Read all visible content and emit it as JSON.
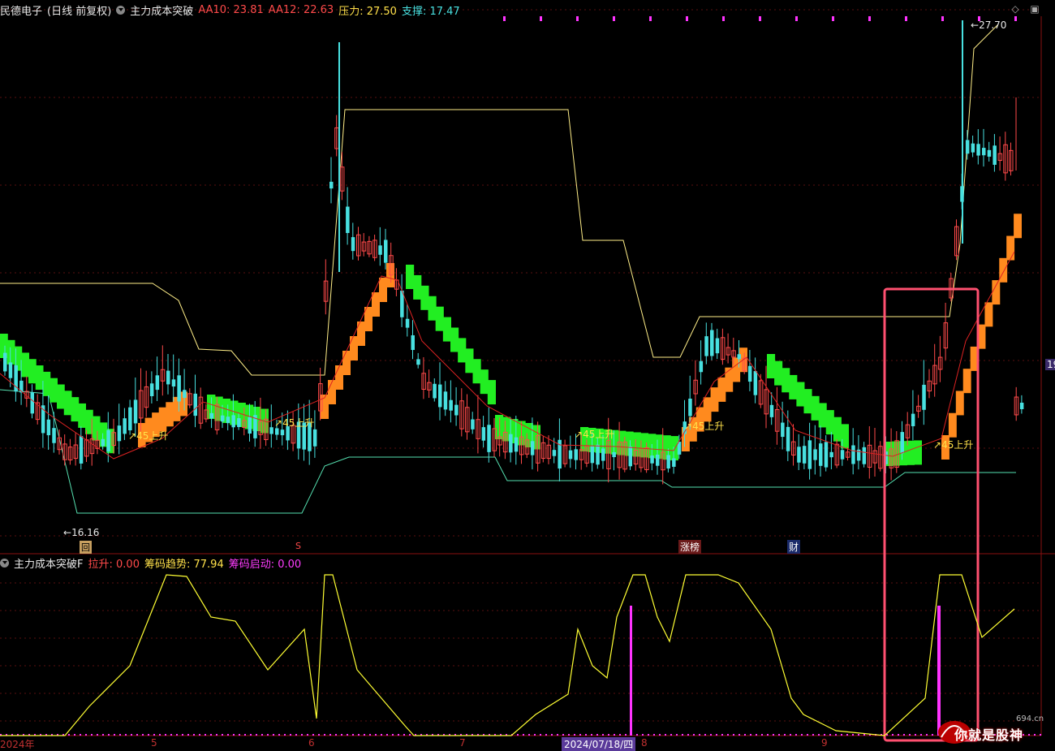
{
  "header": {
    "stock_name": "民德电子",
    "period": "(日线 前复权)",
    "indicator": "主力成本突破",
    "aa10_label": "AA10:",
    "aa10_value": "23.81",
    "aa12_label": "AA12:",
    "aa12_value": "22.63",
    "pressure_label": "压力:",
    "pressure_value": "27.50",
    "support_label": "支撑:",
    "support_value": "17.47"
  },
  "sub_header": {
    "indicator": "主力成本突破F",
    "pull_label": "拉升:",
    "pull_value": "0.00",
    "trend_label": "筹码趋势:",
    "trend_value": "77.94",
    "start_label": "筹码启动:",
    "start_value": "0.00"
  },
  "annotations": {
    "high_price": "27.70",
    "low_price": "16.16",
    "rise_label": "45上升",
    "right_edge_value": "19",
    "date_cursor": "2024/07/18/四"
  },
  "markers": {
    "box_marker": "回",
    "s_marker": "S",
    "limit_marker": "涨榜",
    "fin_marker": "财"
  },
  "x_axis": {
    "labels": [
      "2024年",
      "5",
      "6",
      "7",
      "8",
      "9"
    ]
  },
  "watermark": {
    "text": "你就是股神",
    "site": "694.cn"
  },
  "colors": {
    "up": "#ff4a4a",
    "down": "#48e0e0",
    "band_up": "#ff8a1e",
    "band_down": "#22ee22",
    "resistance": "#ffee88",
    "support": "#55e0b0",
    "trend": "#ffff33",
    "start": "#ff33ff",
    "highlight_box": "#ff5070"
  },
  "icons": {
    "settings": "diamond-icon",
    "close": "square-icon",
    "dropdown": "dot-chevron-icon"
  }
}
